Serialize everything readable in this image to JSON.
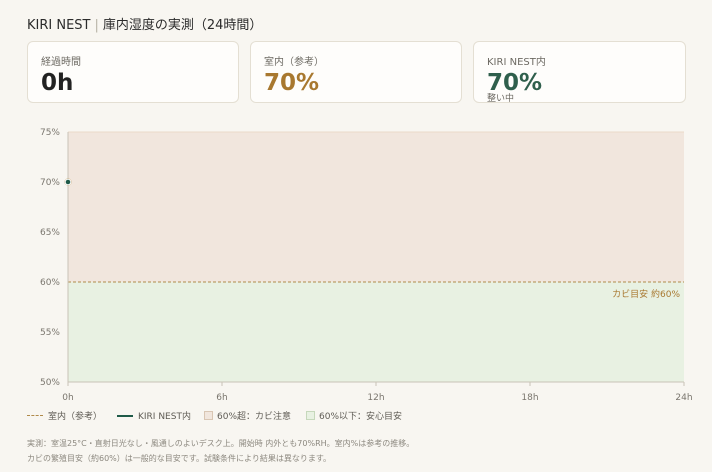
{
  "header": {
    "brand": "KIRI NEST",
    "title": "庫内湿度の実測（24時間）"
  },
  "cards": {
    "elapsed": {
      "label": "経過時間",
      "value": "0h"
    },
    "room": {
      "label": "室内（参考）",
      "value": "70%",
      "color": "#a8782f"
    },
    "nest": {
      "label": "KIRI NEST内",
      "value": "70%",
      "status": "整い中",
      "color": "#2f5f4c"
    }
  },
  "chart_data": {
    "type": "line",
    "x": [
      0
    ],
    "xlim": [
      0,
      24
    ],
    "ylim": [
      50,
      75
    ],
    "x_ticks": [
      "0h",
      "6h",
      "12h",
      "18h",
      "24h"
    ],
    "y_ticks": [
      "50%",
      "55%",
      "60%",
      "65%",
      "70%",
      "75%"
    ],
    "series": [
      {
        "name": "室内（参考）",
        "values": [
          70
        ],
        "style": "dashed",
        "color": "#b08a4a"
      },
      {
        "name": "KIRI NEST内",
        "values": [
          70
        ],
        "style": "solid",
        "color": "#1f5a48"
      }
    ],
    "threshold": {
      "value": 60,
      "label": "カビ目安 約60%",
      "color": "#a8782f"
    },
    "bands": [
      {
        "name": "60%超：カビ注意",
        "from": 60,
        "to": 75,
        "color": "#f1e6dd"
      },
      {
        "name": "60%以下：安心目安",
        "from": 50,
        "to": 60,
        "color": "#e8f1e2"
      }
    ],
    "grid": false,
    "legend_position": "bottom-left"
  },
  "legend": {
    "room": "室内（参考）",
    "nest": "KIRI NEST内",
    "over": "60%超：カビ注意",
    "under": "60%以下：安心目安"
  },
  "notes": {
    "line1": "実測：室温25°C・直射日光なし・風通しのよいデスク上。開始時 内外とも70%RH。室内%は参考の推移。",
    "line2": "カビの繁殖目安（約60%）は一般的な目安です。試験条件により結果は異なります。"
  }
}
